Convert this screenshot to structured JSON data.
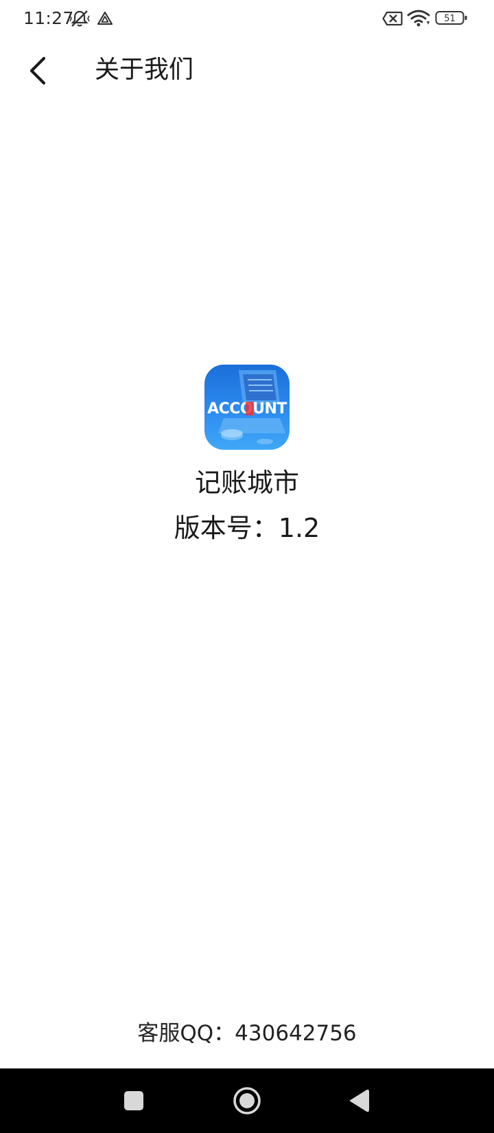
{
  "status_bar": {
    "time": "11:27",
    "battery_level": "51",
    "icons": [
      "mute-vibrate-icon",
      "app-notification-icon",
      "sim-disabled-icon",
      "wifi-icon",
      "battery-icon"
    ]
  },
  "header": {
    "title": "关于我们",
    "back_icon": "chevron-left-icon"
  },
  "app": {
    "logo_text": "ACCOUNT",
    "name": "记账城市",
    "version": "版本号：1.2"
  },
  "footer": {
    "contact": "客服QQ：430642756"
  },
  "nav_bar": {
    "buttons": [
      "recents-square-icon",
      "home-circle-icon",
      "back-triangle-icon"
    ]
  },
  "colors": {
    "background": "#ffffff",
    "text": "#1a1a1a",
    "nav_bar": "#000000",
    "logo_blue": "#1e7fe0",
    "logo_accent_red": "#e8343a"
  }
}
